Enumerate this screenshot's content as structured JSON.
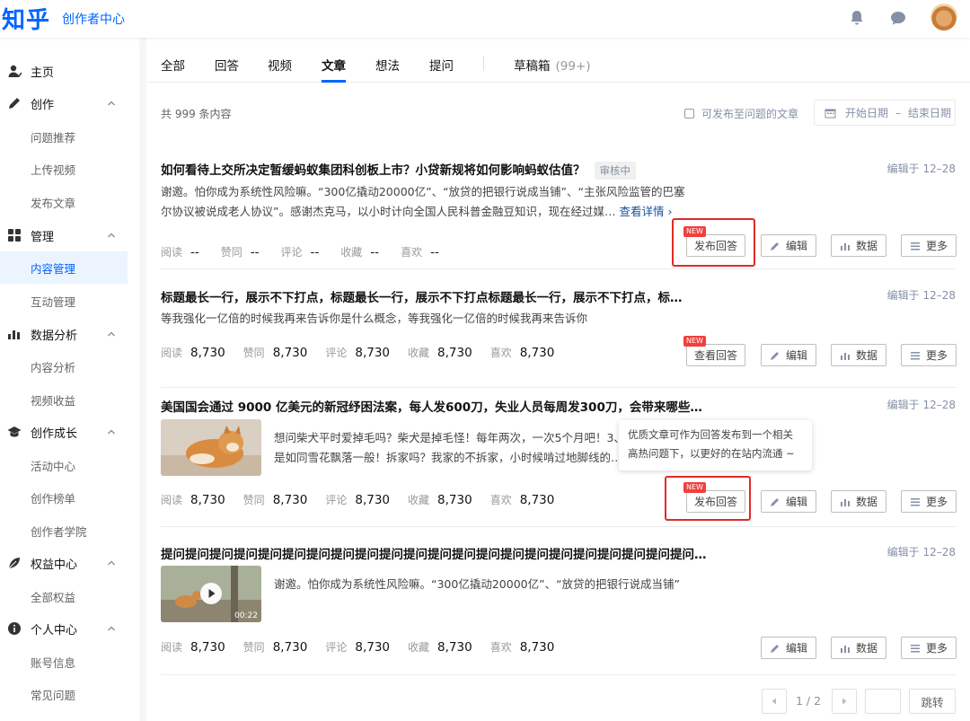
{
  "header": {
    "logo": "知乎",
    "subtitle": "创作者中心",
    "icons": [
      "bell-icon",
      "chat-bubble-icon",
      "avatar"
    ]
  },
  "sidebar": {
    "groups": [
      {
        "label": "主页",
        "icon": "person-icon"
      },
      {
        "label": "创作",
        "icon": "pencil-icon"
      },
      {
        "label": "管理",
        "icon": "grid-icon"
      },
      {
        "label": "数据分析",
        "icon": "bar-chart-icon"
      },
      {
        "label": "创作成长",
        "icon": "graduation-cap-icon"
      },
      {
        "label": "权益中心",
        "icon": "leaf-icon"
      },
      {
        "label": "个人中心",
        "icon": "info-icon"
      }
    ],
    "subs": {
      "create": [
        "问题推荐",
        "上传视频",
        "发布文章"
      ],
      "manage": [
        "内容管理",
        "互动管理"
      ],
      "analytics": [
        "内容分析",
        "视频收益"
      ],
      "growth": [
        "活动中心",
        "创作榜单",
        "创作者学院"
      ],
      "rights": [
        "全部权益"
      ],
      "personal": [
        "账号信息",
        "常见问题"
      ]
    },
    "active": "内容管理"
  },
  "tabs": {
    "items": [
      "全部",
      "回答",
      "视频",
      "文章",
      "想法",
      "提问"
    ],
    "active": "文章",
    "drafts_label": "草稿箱",
    "drafts_count": "(99+)"
  },
  "toolbar": {
    "total": "共 999 条内容",
    "checkbox_label": "可发布至问题的文章",
    "date_start": "开始日期",
    "date_sep": "–",
    "date_end": "结束日期"
  },
  "stat_labels": [
    "阅读",
    "赞同",
    "评论",
    "收藏",
    "喜欢"
  ],
  "buttons": {
    "publish_answer": "发布回答",
    "view_answer": "查看回答",
    "edit": "编辑",
    "data": "数据",
    "more": "更多",
    "new_tag": "NEW"
  },
  "items": [
    {
      "title": "如何看待上交所决定暂缓蚂蚁集团科创板上市？小贷新规将如何影响蚂蚁估值？",
      "badge": "审核中",
      "edit_time": "编辑于 12–28",
      "excerpt_line1": "谢邀。怕你成为系统性风险嘛。“300亿撬动20000亿”、“放贷的把银行说成当铺”、“主张风险监管的巴塞",
      "excerpt_line2": "尔协议被说成老人协议”。感谢杰克马，以小时计向全国人民科普金融豆知识，现在经过媒…",
      "more_link": "查看详情",
      "stats": [
        "--",
        "--",
        "--",
        "--",
        "--"
      ]
    },
    {
      "title": "标题最长一行，展示不下打点，标题最长一行，展示不下打点标题最长一行，展示不下打点，标…",
      "edit_time": "编辑于 12–28",
      "excerpt_line1": "等我强化一亿倍的时候我再来告诉你是什么概念，等我强化一亿倍的时候我再来告诉你",
      "stats": [
        "8,730",
        "8,730",
        "8,730",
        "8,730",
        "8,730"
      ]
    },
    {
      "title": "美国国会通过 9000 亿美元的新冠纾困法案，每人发600刀，失业人员每周发300刀，会带来哪些…",
      "edit_time": "编辑于 12–28",
      "excerpt_line1": "想问柴犬平时爱掉毛吗？柴犬是掉毛怪！每年两次，一次5个月吧！3、",
      "excerpt_line2": "是如同雪花飘落一般！拆家吗？我家的不拆家，小时候啃过地脚线的…",
      "stats": [
        "8,730",
        "8,730",
        "8,730",
        "8,730",
        "8,730"
      ],
      "tooltip_line1": "优质文章可作为回答发布到一个相关",
      "tooltip_line2": "高热问题下，以更好的在站内流通 ~"
    },
    {
      "title": "提问提问提问提问提问提问提问提问提问提问提问提问提问提问提问提问提问提问提问提问提问提问…",
      "edit_time": "编辑于 12–28",
      "excerpt_line1": "谢邀。怕你成为系统性风险嘛。“300亿撬动20000亿”、“放贷的把银行说成当铺”",
      "video_duration": "00:22",
      "stats": [
        "8,730",
        "8,730",
        "8,730",
        "8,730",
        "8,730"
      ]
    }
  ],
  "pagination": {
    "page_text": "1 / 2",
    "go_label": "跳转"
  }
}
